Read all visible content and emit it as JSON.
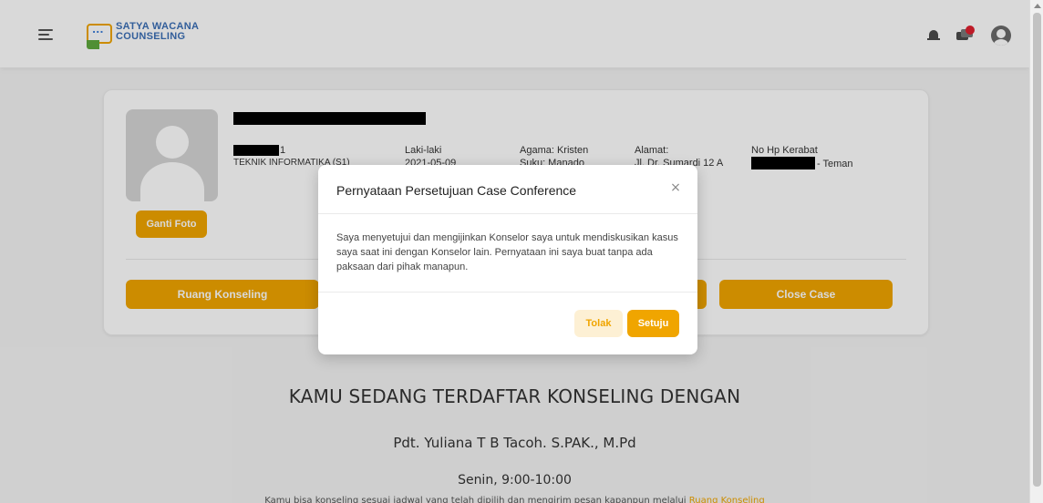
{
  "header": {
    "logo_line1": "SATYA WACANA",
    "logo_line2": "COUNSELING",
    "icons": [
      "menu-icon",
      "bell-icon",
      "chat-icon",
      "user-icon"
    ],
    "notification_color": "#e0202e"
  },
  "profile": {
    "change_photo_label": "Ganti Foto",
    "student_id_suffix": "1",
    "program": "TEKNIK INFORMATIKA (S1)",
    "gender": "Laki-laki",
    "date": "2021-05-09",
    "religion": "Agama: Kristen",
    "ethnicity": "Suku: Manado",
    "address_label": "Alamat:",
    "address": "Jl. Dr. Sumardi 12 A",
    "relative_phone_label": "No Hp Kerabat",
    "relative_relation": "- Teman"
  },
  "actions": {
    "counseling_room": "Ruang Konseling",
    "close_case": "Close Case"
  },
  "registration": {
    "title": "KAMU SEDANG TERDAFTAR KONSELING DENGAN",
    "counselor": "Pdt. Yuliana T B Tacoh. S.PAK., M.Pd",
    "schedule": "Senin, 9:00-10:00",
    "note_text": "Kamu bisa konseling sesuai jadwal yang telah dipilih dan mengirim pesan kapanpun melalui ",
    "note_link": "Ruang Konseling"
  },
  "modal": {
    "title": "Pernyataan Persetujuan Case Conference",
    "close_symbol": "×",
    "body": "Saya menyetujui dan mengijinkan Konselor saya untuk mendiskusikan kasus saya saat ini dengan Konselor lain. Pernyataan ini saya buat tanpa ada paksaan dari pihak manapun.",
    "reject_label": "Tolak",
    "accept_label": "Setuju"
  },
  "colors": {
    "accent": "#f0a500",
    "accent_light": "#fdf0d4",
    "logo_blue": "#3b6fb6"
  }
}
